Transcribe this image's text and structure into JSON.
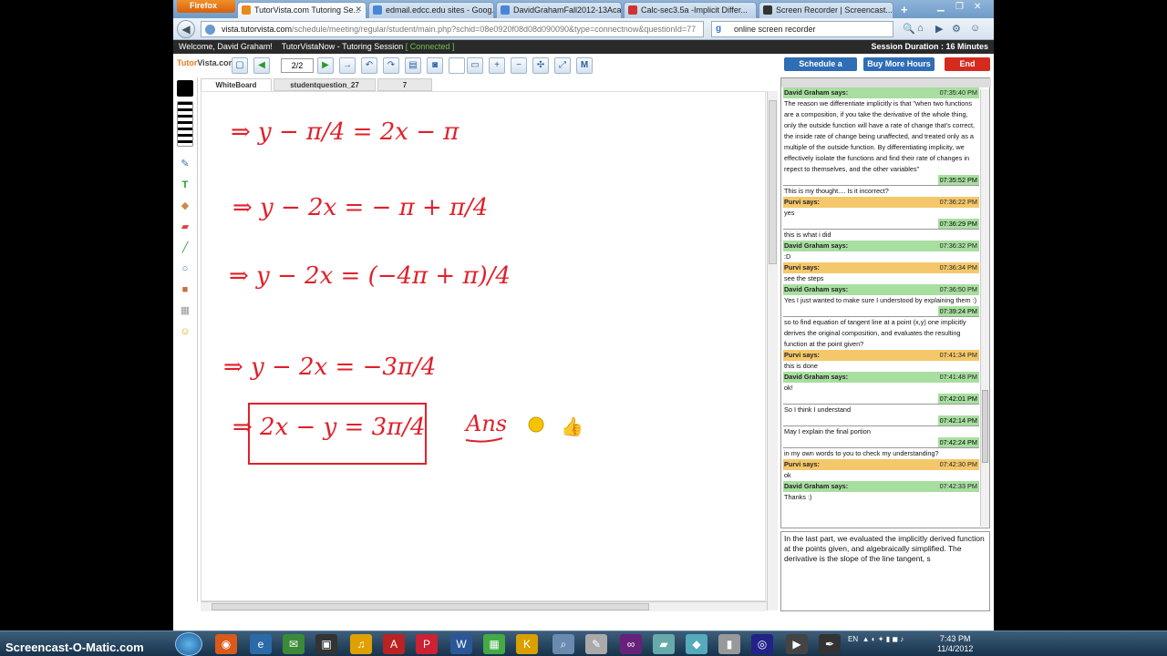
{
  "browser": {
    "firefox_label": "Firefox",
    "tabs": [
      {
        "label": "TutorVista.com Tutoring Se...",
        "active": true
      },
      {
        "label": "edmail.edcc.edu sites - Goog..."
      },
      {
        "label": "DavidGrahamFall2012-13Aca..."
      },
      {
        "label": "Calc-sec3.5a -Implicit Differ..."
      },
      {
        "label": "Screen Recorder | Screencast..."
      }
    ],
    "url_domain": "vista.tutorvista.com",
    "url_rest": "/schedule/meeting/regular/student/main.php?schid=08e0920f08d08d090090&type=connectnow&questionId=77",
    "search_value": "online screen recorder"
  },
  "session": {
    "welcome": "Welcome, David Graham!",
    "title": "TutorVistaNow - Tutoring Session",
    "status": "[ Connected ]",
    "duration": "Session Duration : 16 Minutes"
  },
  "toolbar": {
    "logo_a": "Tutor",
    "logo_b": "Vista.com",
    "page": "2/2",
    "schedule": "Schedule a session",
    "buy": "Buy More Hours",
    "end": "End Session"
  },
  "wb_tabs": [
    "WhiteBoard",
    "studentquestion_27",
    "7"
  ],
  "whiteboard_lines": [
    "⇒ y − π/4 = 2x − π",
    "⇒ y − 2x = − π + π/4",
    "⇒ y − 2x = (−4π + π)/4",
    "⇒ y − 2x = −3π/4",
    "⇒ 2x − y = 3π/4",
    "Ans"
  ],
  "chat": [
    {
      "who": "David Graham says:",
      "time": "07:35:40 PM",
      "kind": "dg",
      "text": "The reason we differentiate implicitly is that \"when two functions are a composition, if you take the derivative of the whole thing, only the outside function will have a rate of change that's correct, the inside rate of change being unaffected, and treated only as a multiple of the outside function. By differentiating implicity, we effectively isolate the functions and find their rate of changes in repect to themselves, and the other variables\""
    },
    {
      "who": "",
      "time": "07:35:52 PM",
      "kind": "sep",
      "text": "This is my thought.... Is it incorrect?"
    },
    {
      "who": "Purvi says:",
      "time": "07:36:22 PM",
      "kind": "pv",
      "text": "yes"
    },
    {
      "who": "",
      "time": "07:36:29 PM",
      "kind": "sep",
      "text": "this is what i did"
    },
    {
      "who": "David Graham says:",
      "time": "07:36:32 PM",
      "kind": "dg",
      "text": ":D"
    },
    {
      "who": "Purvi says:",
      "time": "07:36:34 PM",
      "kind": "pv",
      "text": "see the steps"
    },
    {
      "who": "David Graham says:",
      "time": "07:36:50 PM",
      "kind": "dg",
      "text": "Yes I just wanted to make sure I understood by explaining them :)"
    },
    {
      "who": "",
      "time": "07:39:24 PM",
      "kind": "sep",
      "text": "so to find equation of tangent line at a point (x,y) one implicitly derives the original composition, and evaluates the resulting function at the point given?"
    },
    {
      "who": "Purvi says:",
      "time": "07:41:34 PM",
      "kind": "pv",
      "text": "this is done"
    },
    {
      "who": "David Graham says:",
      "time": "07:41:48 PM",
      "kind": "dg",
      "text": "ok!"
    },
    {
      "who": "",
      "time": "07:42:01 PM",
      "kind": "sep",
      "text": "So I think I understand"
    },
    {
      "who": "",
      "time": "07:42:14 PM",
      "kind": "sep",
      "text": "May I explain the final portion"
    },
    {
      "who": "",
      "time": "07:42:24 PM",
      "kind": "sep",
      "text": "in my own words to you to check my understanding?"
    },
    {
      "who": "Purvi says:",
      "time": "07:42:30 PM",
      "kind": "pv",
      "text": "ok"
    },
    {
      "who": "David Graham says:",
      "time": "07:42:33 PM",
      "kind": "dg",
      "text": "Thanks :)"
    }
  ],
  "input_text": "In the last part, we evaluated the implicitly derived function at the points given, and algebraically simplified. The derivative is the slope of the line tangent, s",
  "taskbar": {
    "lang": "EN",
    "time": "7:43 PM",
    "date": "11/4/2012",
    "watermark": "Screencast-O-Matic.com"
  },
  "colors": {
    "ink": "#e0202a",
    "chat_david": "#a8dea0",
    "chat_purvi": "#f4c86a",
    "end_btn": "#d42b1e",
    "action_btn": "#2f6db5"
  }
}
